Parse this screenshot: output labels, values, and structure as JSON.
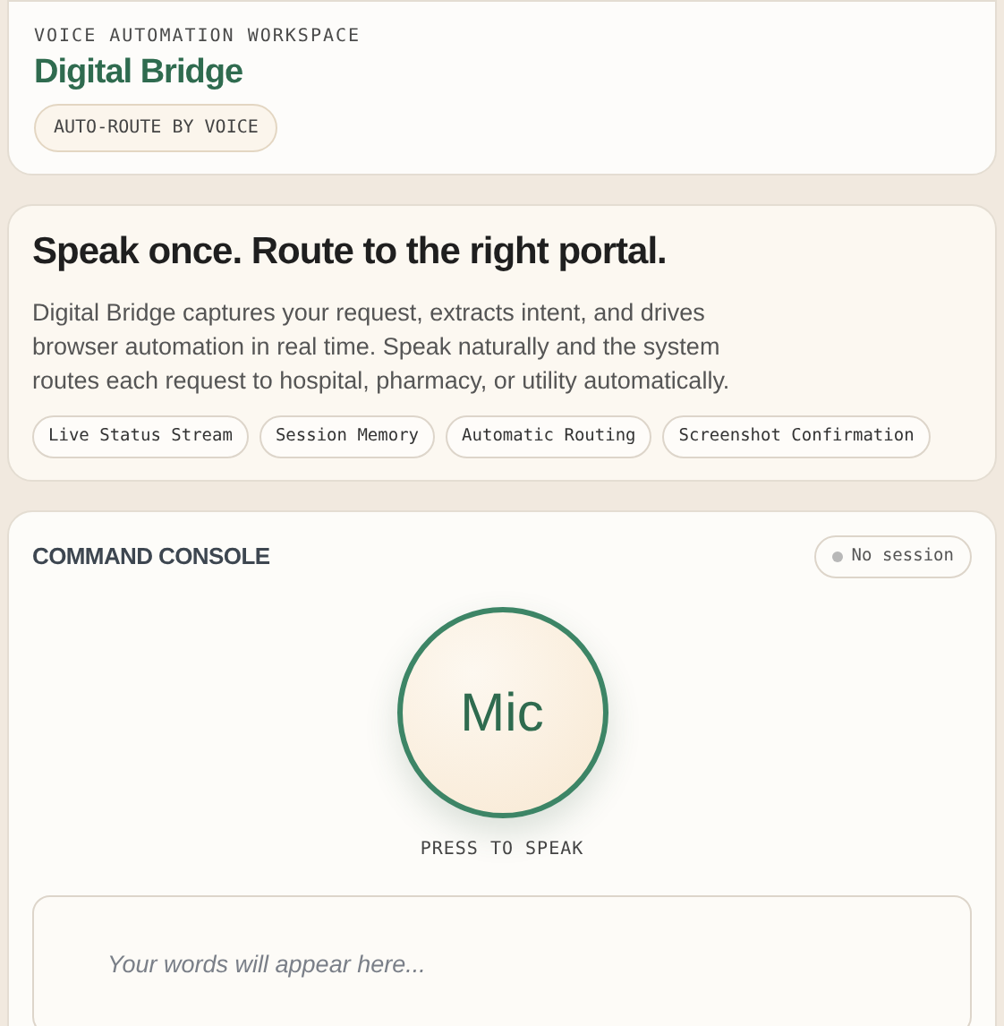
{
  "header": {
    "eyebrow": "VOICE AUTOMATION WORKSPACE",
    "title": "Digital Bridge",
    "badge": "AUTO-ROUTE BY VOICE"
  },
  "hero": {
    "headline": "Speak once. Route to the right portal.",
    "description": "Digital Bridge captures your request, extracts intent, and drives browser automation in real time. Speak naturally and the system routes each request to hospital, pharmacy, or utility automatically.",
    "features": [
      "Live Status Stream",
      "Session Memory",
      "Automatic Routing",
      "Screenshot Confirmation"
    ]
  },
  "console": {
    "title": "COMMAND CONSOLE",
    "session_status": "No session",
    "mic_button": "Mic",
    "mic_hint": "PRESS TO SPEAK",
    "transcript": {
      "placeholder": "Your words will appear here..."
    }
  }
}
